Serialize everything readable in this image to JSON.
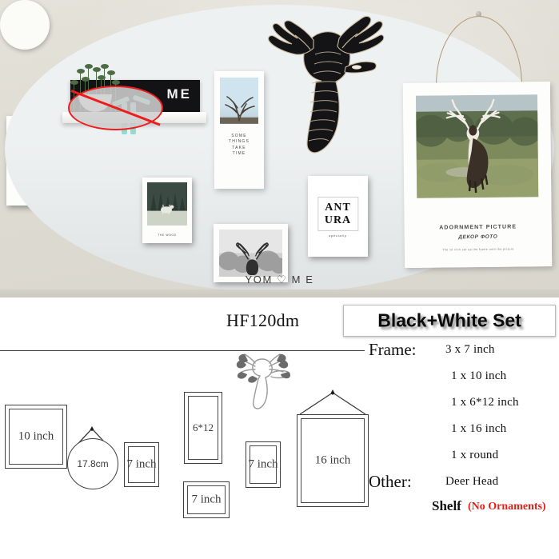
{
  "product": {
    "model_code": "HF120dm",
    "set_badge": "Black+White Set"
  },
  "spec_list": {
    "frame_label": "Frame:",
    "frame_items": [
      "3 x 7 inch",
      "1 x 10 inch",
      "1 x 6*12 inch",
      "1 x 16 inch",
      "1 x  round"
    ],
    "other_label": "Other:",
    "other_value": "Deer Head",
    "shelf_label": "Shelf",
    "shelf_note": "(No Ornaments)",
    "shelf_note_color": "#e2231a"
  },
  "diagram": {
    "frames": [
      {
        "id": "10inch",
        "label": "10 inch"
      },
      {
        "id": "yom",
        "label": "YOM ♡ M E"
      },
      {
        "id": "round",
        "label": "17.8cm"
      },
      {
        "id": "7a",
        "label": "7 inch"
      },
      {
        "id": "612",
        "label": "6*12"
      },
      {
        "id": "7b",
        "label": "7 inch"
      },
      {
        "id": "7c",
        "label": "7 inch"
      },
      {
        "id": "16inch",
        "label": "16 inch"
      }
    ],
    "deer_head_icon": "deer-head-outline"
  },
  "photo": {
    "frames": {
      "ant_line1": "ANT",
      "ant_line2": "URA",
      "ant_sub": "specially",
      "shelf_letters": "ME",
      "tall_caption": "SOME\nTHINGS\nTAKE\nTIME",
      "logs_caption": "THE WOOD",
      "big_caption_line1": "ADORNMENT PICTURE",
      "big_caption_line2": "ДЕКОР ФОТО",
      "big_caption_line3": "The 16 inch set up the frame onto the picture"
    },
    "no_ornament_symbol": "prohibition-ellipse"
  },
  "colors": {
    "wall": "#e0ddd4",
    "frame_black": "#17171a",
    "frame_white": "#fbfbf8",
    "warning_red": "#ee1c1c",
    "panel_bg": "#ffffff",
    "line_art": "#3f3f3f"
  }
}
